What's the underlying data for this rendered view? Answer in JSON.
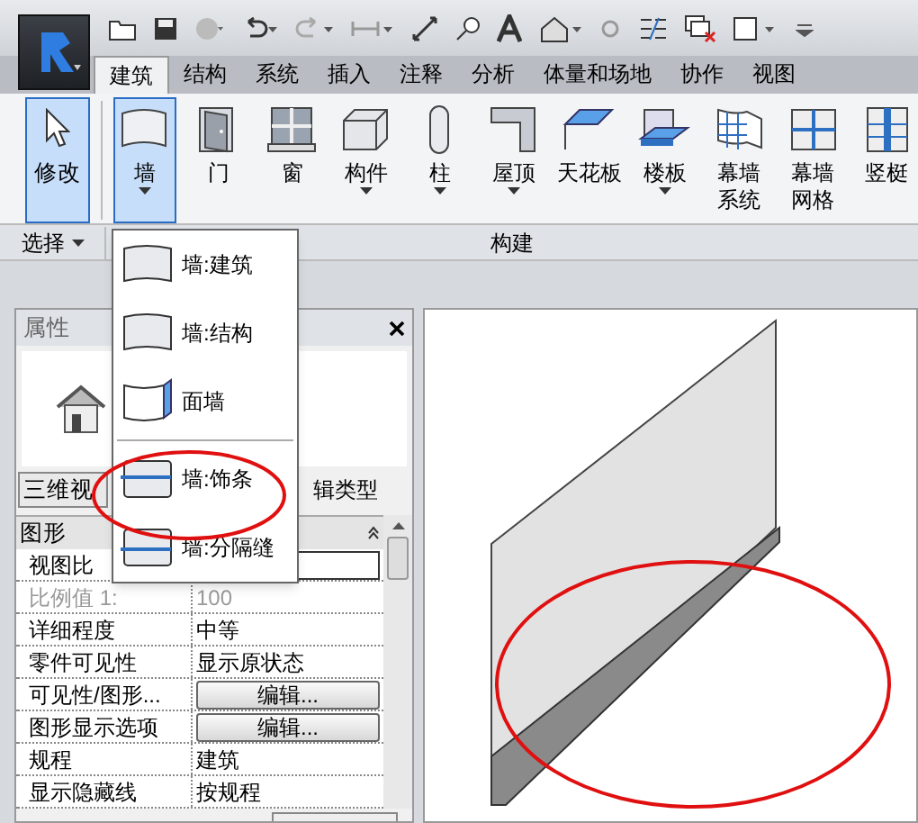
{
  "tabs": [
    {
      "label": "建筑",
      "selected": true
    },
    {
      "label": "结构",
      "selected": false
    },
    {
      "label": "系统",
      "selected": false
    },
    {
      "label": "插入",
      "selected": false
    },
    {
      "label": "注释",
      "selected": false
    },
    {
      "label": "分析",
      "selected": false
    },
    {
      "label": "体量和场地",
      "selected": false
    },
    {
      "label": "协作",
      "selected": false
    },
    {
      "label": "视图",
      "selected": false
    }
  ],
  "ribbon": {
    "modify": {
      "label": "修改",
      "selected": true
    },
    "tools": [
      {
        "label": "墙",
        "selected": true,
        "caret": true
      },
      {
        "label": "门",
        "selected": false,
        "caret": false
      },
      {
        "label": "窗",
        "selected": false,
        "caret": false
      },
      {
        "label": "构件",
        "selected": false,
        "caret": true
      },
      {
        "label": "柱",
        "selected": false,
        "caret": true
      },
      {
        "label": "屋顶",
        "selected": false,
        "caret": true
      },
      {
        "label": "天花板",
        "selected": false,
        "caret": false
      },
      {
        "label": "楼板",
        "selected": false,
        "caret": true
      },
      {
        "label": "幕墙系统",
        "selected": false,
        "caret": false
      },
      {
        "label": "幕墙网格",
        "selected": false,
        "caret": false
      },
      {
        "label": "竖梃",
        "selected": false,
        "caret": false
      }
    ],
    "panels": [
      {
        "label": "选择",
        "caret": true
      },
      {
        "label": "构建",
        "caret": false
      }
    ]
  },
  "wall_menu": {
    "items": [
      {
        "label": "墙:建筑",
        "separator_before": false
      },
      {
        "label": "墙:结构",
        "separator_before": false
      },
      {
        "label": "面墙",
        "separator_before": false
      },
      {
        "label": "墙:饰条",
        "separator_before": true
      },
      {
        "label": "墙:分隔缝",
        "separator_before": false
      }
    ]
  },
  "properties": {
    "title": "属性",
    "type_selector": "三维视",
    "edit_type": "辑类型",
    "group": "图形",
    "rows": [
      {
        "label": "视图比",
        "value": "",
        "kind": "field",
        "disabled": false
      },
      {
        "label": "比例值 1:",
        "value": "100",
        "kind": "text",
        "disabled": true
      },
      {
        "label": "详细程度",
        "value": "中等",
        "kind": "text",
        "disabled": false
      },
      {
        "label": "零件可见性",
        "value": "显示原状态",
        "kind": "text",
        "disabled": false
      },
      {
        "label": "可见性/图形...",
        "value": "编辑...",
        "kind": "button",
        "disabled": false
      },
      {
        "label": "图形显示选项",
        "value": "编辑...",
        "kind": "button",
        "disabled": false
      },
      {
        "label": "规程",
        "value": "建筑",
        "kind": "text",
        "disabled": false
      },
      {
        "label": "显示隐藏线",
        "value": "按规程",
        "kind": "text",
        "disabled": false
      }
    ]
  }
}
